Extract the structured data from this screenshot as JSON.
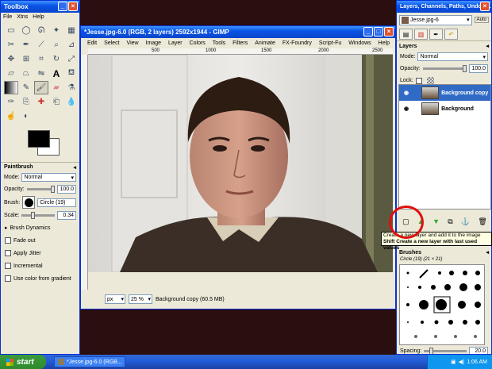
{
  "toolbox": {
    "title": "Toolbox",
    "menu": [
      "File",
      "Xtns",
      "Help"
    ],
    "tool_options": {
      "title": "Paintbrush",
      "mode_label": "Mode:",
      "mode_value": "Normal",
      "opacity_label": "Opacity:",
      "opacity_value": "100.0",
      "opacity_level": 1.0,
      "brush_label": "Brush:",
      "brush_value": "Circle (19)",
      "scale_label": "Scale:",
      "scale_value": "0.34",
      "scale_level": 0.34,
      "brush_dynamics": "Brush Dynamics",
      "checkboxes": [
        "Fade out",
        "Apply Jitter",
        "Incremental",
        "Use color from gradient"
      ]
    },
    "foreground_color": "#000000",
    "background_color": "#ffffff",
    "icons": [
      "rect-select-icon",
      "ellipse-select-icon",
      "free-select-icon",
      "fuzzy-select-icon",
      "color-select-icon",
      "scissors-icon",
      "paths-icon",
      "color-picker-icon",
      "zoom-icon",
      "measure-icon",
      "move-icon",
      "align-icon",
      "crop-icon",
      "rotate-icon",
      "scale-icon",
      "shear-icon",
      "perspective-icon",
      "flip-icon",
      "text-icon",
      "bucket-fill-icon",
      "blend-icon",
      "pencil-icon",
      "paintbrush-icon",
      "eraser-icon",
      "airbrush-icon",
      "ink-icon",
      "clone-icon",
      "heal-icon",
      "perspective-clone-icon",
      "blur-icon",
      "smudge-icon",
      "dodge-burn-icon"
    ]
  },
  "image_window": {
    "title": "*Jesse.jpg-6.0 (RGB, 2 layers) 2592x1944 - GIMP",
    "menu": [
      "Edit",
      "Select",
      "View",
      "Image",
      "Layer",
      "Colors",
      "Tools",
      "Filters",
      "Animate",
      "FX-Foundry",
      "Script-Fu",
      "Windows",
      "Help"
    ],
    "ruler_marks": [
      "500",
      "1000",
      "1500",
      "2000",
      "2500"
    ],
    "unit": "px",
    "zoom": "25 %",
    "status": "Background copy (60.5 MB)"
  },
  "dock": {
    "title": "Layers, Channels, Paths, Undo - ...",
    "image_selector": "Jesse.jpg-6",
    "layers_title": "Layers",
    "mode_label": "Mode:",
    "mode_value": "Normal",
    "opacity_label": "Opacity:",
    "opacity_value": "100.0",
    "lock_label": "Lock:",
    "layers": [
      {
        "name": "Background copy",
        "selected": true
      },
      {
        "name": "Background",
        "selected": false
      }
    ],
    "tooltip_line1": "Create a new layer and add it to the image",
    "tooltip_line2": "Shift  Create a new layer with last used values",
    "brushes_title": "Brushes",
    "brush_name": "Circle (19) (21 × 21)",
    "spacing_label": "Spacing:",
    "spacing_value": "20.0"
  },
  "taskbar": {
    "start": "start",
    "task": "*Jesse.jpg-6.0 (RGB...",
    "time": "1:06 AM"
  }
}
